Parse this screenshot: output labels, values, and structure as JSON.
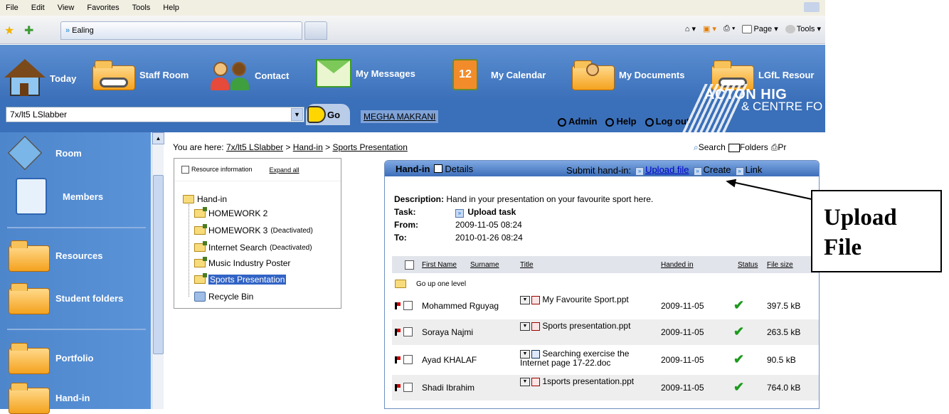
{
  "browser": {
    "menu": [
      "File",
      "Edit",
      "View",
      "Favorites",
      "Tools",
      "Help"
    ],
    "tab_title": "Ealing",
    "commands": [
      "Page",
      "Tools"
    ]
  },
  "nav": {
    "items": [
      "Today",
      "Staff Room",
      "Contact",
      "My Messages",
      "My Calendar",
      "My Documents",
      "LGfL Resour"
    ],
    "calendar_day": "12"
  },
  "logo": {
    "line1": "ACTON HIG",
    "line2": "& CENTRE FO"
  },
  "toolbar": {
    "room_select": "7x/lt5 LSlabber",
    "go_label": "Go",
    "user": "MEGHA MAKRANI",
    "links": [
      "Admin",
      "Help",
      "Log out"
    ]
  },
  "sidebar": {
    "items": [
      "Room",
      "Members",
      "Resources",
      "Student folders",
      "Portfolio",
      "Hand-in"
    ]
  },
  "breadcrumb": {
    "prefix": "You are here:",
    "parts": [
      "7x/lt5 LSlabber",
      "Hand-in",
      "Sports Presentation"
    ],
    "sep": ">"
  },
  "right_tools": [
    "Search",
    "Folders",
    "Pr"
  ],
  "tree": {
    "resource_info": "Resource information",
    "expand_all": "Expand all",
    "root": "Hand-in",
    "children": [
      {
        "label": "HOMEWORK 2",
        "note": ""
      },
      {
        "label": "HOMEWORK 3",
        "note": "(Deactivated)"
      },
      {
        "label": "Internet Search",
        "note": "(Deactivated)"
      },
      {
        "label": "Music Industry Poster",
        "note": ""
      },
      {
        "label": "Sports Presentation",
        "note": ""
      },
      {
        "label": "Recycle Bin",
        "note": ""
      }
    ]
  },
  "panel": {
    "title": "Hand-in",
    "details": "Details",
    "submit_label": "Submit hand-in:",
    "actions": [
      "Upload file",
      "Create",
      "Link"
    ],
    "description_label": "Description:",
    "description": "Hand in your presentation on your favourite sport here.",
    "task_label": "Task:",
    "task": "Upload task",
    "from_label": "From:",
    "from": "2009-11-05 08:24",
    "to_label": "To:",
    "to": "2010-01-26 08:24",
    "columns": [
      "First Name",
      "Surname",
      "Title",
      "Handed in",
      "Status",
      "File size"
    ],
    "go_up": "Go up one level",
    "rows": [
      {
        "name": "Mohammed Rguyag",
        "title": "My Favourite Sport.ppt",
        "date": "2009-11-05",
        "size": "397.5 kB",
        "type": "ppt"
      },
      {
        "name": "Soraya Najmi",
        "title": "Sports presentation.ppt",
        "date": "2009-11-05",
        "size": "263.5 kB",
        "type": "ppt"
      },
      {
        "name": "Ayad KHALAF",
        "title": "Searching exercise the Internet page 17-22.doc",
        "date": "2009-11-05",
        "size": "90.5 kB",
        "type": "doc"
      },
      {
        "name": "Shadi Ibrahim",
        "title": "1sports presentation.ppt",
        "date": "2009-11-05",
        "size": "764.0 kB",
        "type": "ppt"
      }
    ]
  },
  "callout": {
    "line1": "Upload",
    "line2": "File"
  }
}
